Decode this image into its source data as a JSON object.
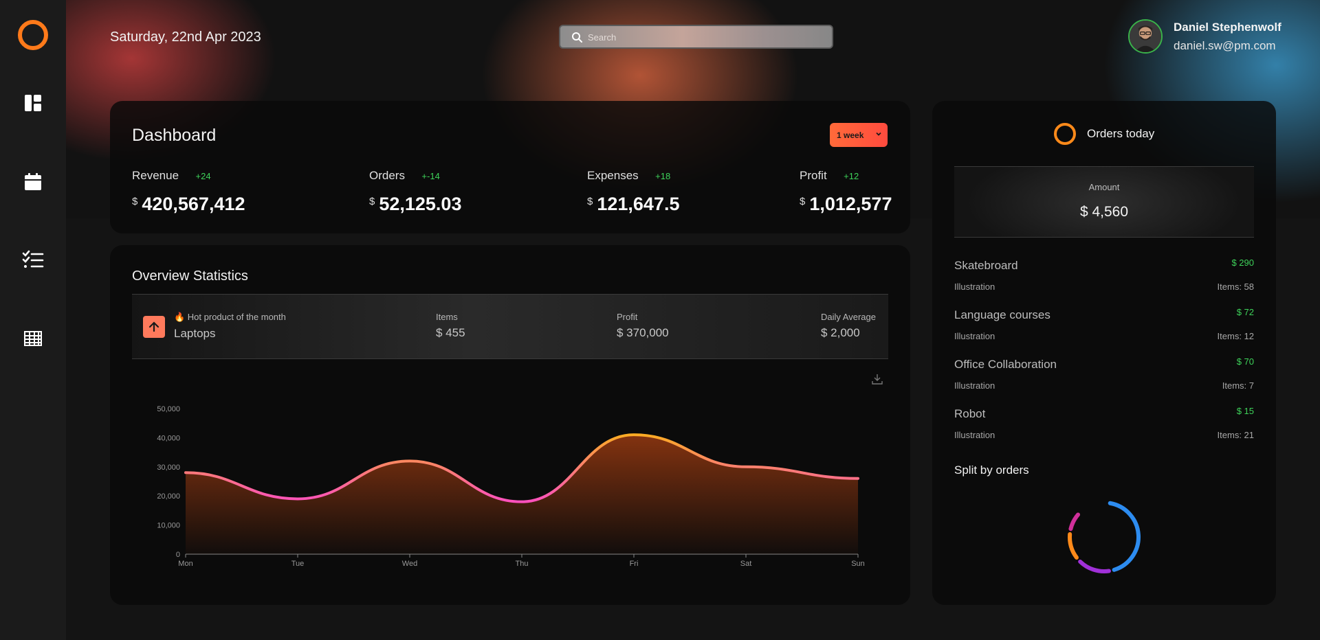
{
  "header": {
    "date": "Saturday, 22nd Apr 2023",
    "search_placeholder": "Search",
    "user_name": "Daniel Stephenwolf",
    "user_email": "daniel.sw@pm.com"
  },
  "sidebar": {
    "items": [
      {
        "icon": "dashboard-icon"
      },
      {
        "icon": "calendar-icon"
      },
      {
        "icon": "checklist-icon"
      },
      {
        "icon": "table-grid-icon"
      }
    ]
  },
  "dashboard": {
    "title": "Dashboard",
    "period": "1 week",
    "metrics": [
      {
        "label": "Revenue",
        "delta": "+24",
        "currency": "$",
        "value": "420,567,412"
      },
      {
        "label": "Orders",
        "delta": "+-14",
        "currency": "$",
        "value": "52,125.03"
      },
      {
        "label": "Expenses",
        "delta": "+18",
        "currency": "$",
        "value": "121,647.5"
      },
      {
        "label": "Profit",
        "delta": "+12",
        "currency": "$",
        "value": "1,012,577"
      }
    ]
  },
  "overview": {
    "title": "Overview Statistics",
    "hot_label": "🔥 Hot product of the month",
    "hot_product": "Laptops",
    "items_label": "Items",
    "items_value": "$ 455",
    "profit_label": "Profit",
    "profit_value": "$ 370,000",
    "avg_label": "Daily Average",
    "avg_value": "$ 2,000"
  },
  "chart_data": {
    "type": "area",
    "categories": [
      "Mon",
      "Tue",
      "Wed",
      "Thu",
      "Fri",
      "Sat",
      "Sun"
    ],
    "series": [
      {
        "values": [
          28000,
          19000,
          32000,
          18000,
          41000,
          30000,
          26000
        ]
      }
    ],
    "yticks": [
      "0",
      "10,000",
      "20,000",
      "30,000",
      "40,000",
      "50,000"
    ],
    "ylim": [
      0,
      50000
    ],
    "grid": false,
    "colors": {
      "line_low": "#ff4fc2",
      "line_high": "#ffb21a",
      "fill": "#8a3510"
    }
  },
  "orders_today": {
    "title": "Orders today",
    "amount_label": "Amount",
    "amount_value": "$ 4,560",
    "items": [
      {
        "name": "Skatebroard",
        "price": "$ 290",
        "sub": "Illustration",
        "items": "Items: 58"
      },
      {
        "name": "Language courses",
        "price": "$ 72",
        "sub": "Illustration",
        "items": "Items: 12"
      },
      {
        "name": "Office Collaboration",
        "price": "$ 70",
        "sub": "Illustration",
        "items": "Items: 7"
      },
      {
        "name": "Robot",
        "price": "$ 15",
        "sub": "Illustration",
        "items": "Items: 21"
      }
    ],
    "split_title": "Split by orders",
    "split": [
      {
        "share": 0.45,
        "color": "#2d8cf0"
      },
      {
        "share": 0.17,
        "color": "#a030d8"
      },
      {
        "share": 0.14,
        "color": "#ff8a1a"
      },
      {
        "share": 0.1,
        "color": "#d0309a"
      }
    ]
  }
}
